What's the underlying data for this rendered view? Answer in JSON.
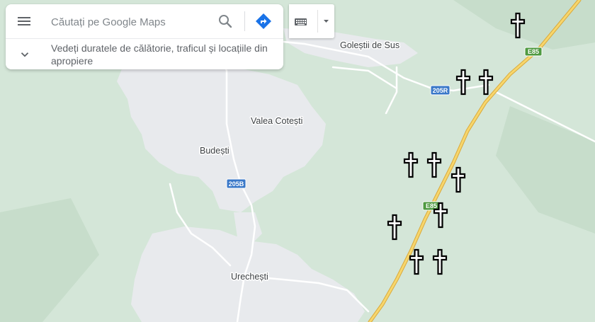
{
  "search": {
    "placeholder": "Căutați pe Google Maps",
    "expand_text": "Vedeți duratele de călătorie, traficul și locațiile din apropiere"
  },
  "places": {
    "golestii": "Goleștii de Sus",
    "valea": "Valea Cotești",
    "budesti": "Budești",
    "urechesti": "Urechești"
  },
  "roads": {
    "r205r": "205R",
    "r205b": "205B",
    "e85_top": "E85",
    "e85_mid": "E85"
  },
  "markers": {
    "cross_count": 11
  },
  "colors": {
    "land": "#d4e6d8",
    "urban": "#e8eaed",
    "highway": "#f7d66c",
    "road_shield_blue": "#3a78c8",
    "road_shield_green": "#4f9a41"
  }
}
